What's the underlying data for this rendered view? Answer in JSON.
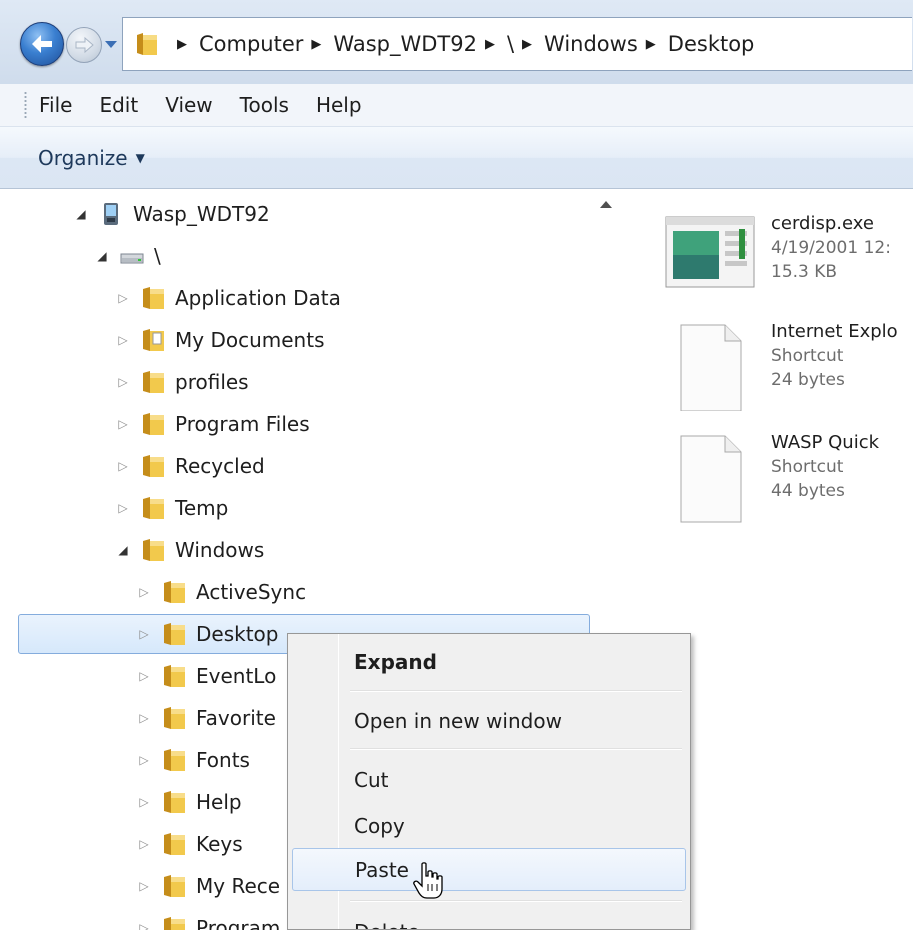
{
  "breadcrumb": {
    "items": [
      "Computer",
      "Wasp_WDT92",
      "\\",
      "Windows",
      "Desktop"
    ]
  },
  "menubar": {
    "items": [
      "File",
      "Edit",
      "View",
      "Tools",
      "Help"
    ]
  },
  "commandbar": {
    "organize_label": "Organize"
  },
  "tree": {
    "items": [
      {
        "label": "Wasp_WDT92",
        "state": "expanded",
        "icon": "mobile-device-icon"
      },
      {
        "label": "\\",
        "state": "expanded",
        "icon": "drive-icon"
      },
      {
        "label": "Application Data",
        "state": "collapsed",
        "icon": "folder-icon"
      },
      {
        "label": "My Documents",
        "state": "collapsed",
        "icon": "documents-folder-icon"
      },
      {
        "label": "profiles",
        "state": "collapsed",
        "icon": "folder-icon"
      },
      {
        "label": "Program Files",
        "state": "collapsed",
        "icon": "folder-icon"
      },
      {
        "label": "Recycled",
        "state": "collapsed",
        "icon": "folder-icon"
      },
      {
        "label": "Temp",
        "state": "collapsed",
        "icon": "folder-icon"
      },
      {
        "label": "Windows",
        "state": "expanded",
        "icon": "folder-icon"
      },
      {
        "label": "ActiveSync",
        "state": "collapsed",
        "icon": "folder-icon"
      },
      {
        "label": "Desktop",
        "state": "collapsed",
        "icon": "folder-icon",
        "selected": true
      },
      {
        "label": "EventLo",
        "state": "collapsed",
        "icon": "folder-icon"
      },
      {
        "label": "Favorite",
        "state": "collapsed",
        "icon": "folder-icon"
      },
      {
        "label": "Fonts",
        "state": "collapsed",
        "icon": "folder-icon"
      },
      {
        "label": "Help",
        "state": "collapsed",
        "icon": "folder-icon"
      },
      {
        "label": "Keys",
        "state": "collapsed",
        "icon": "folder-icon"
      },
      {
        "label": "My Rece",
        "state": "collapsed",
        "icon": "folder-icon"
      },
      {
        "label": "Program",
        "state": "collapsed",
        "icon": "folder-icon"
      }
    ]
  },
  "files": [
    {
      "name": "cerdisp.exe",
      "line2": "4/19/2001 12:",
      "line3": "15.3 KB",
      "icon": "application-icon"
    },
    {
      "name": "Internet Explo",
      "line2": "Shortcut",
      "line3": "24 bytes",
      "icon": "shortcut-file-icon"
    },
    {
      "name": "WASP Quick",
      "line2": "Shortcut",
      "line3": "44 bytes",
      "icon": "shortcut-file-icon"
    }
  ],
  "context_menu": {
    "expand": "Expand",
    "open_new_window": "Open in new window",
    "cut": "Cut",
    "copy": "Copy",
    "paste": "Paste",
    "delete": "Delete"
  },
  "colors": {
    "folder": "#e8b830",
    "selection_border": "#84acdd",
    "accent_blue": "#3a7fd0"
  }
}
